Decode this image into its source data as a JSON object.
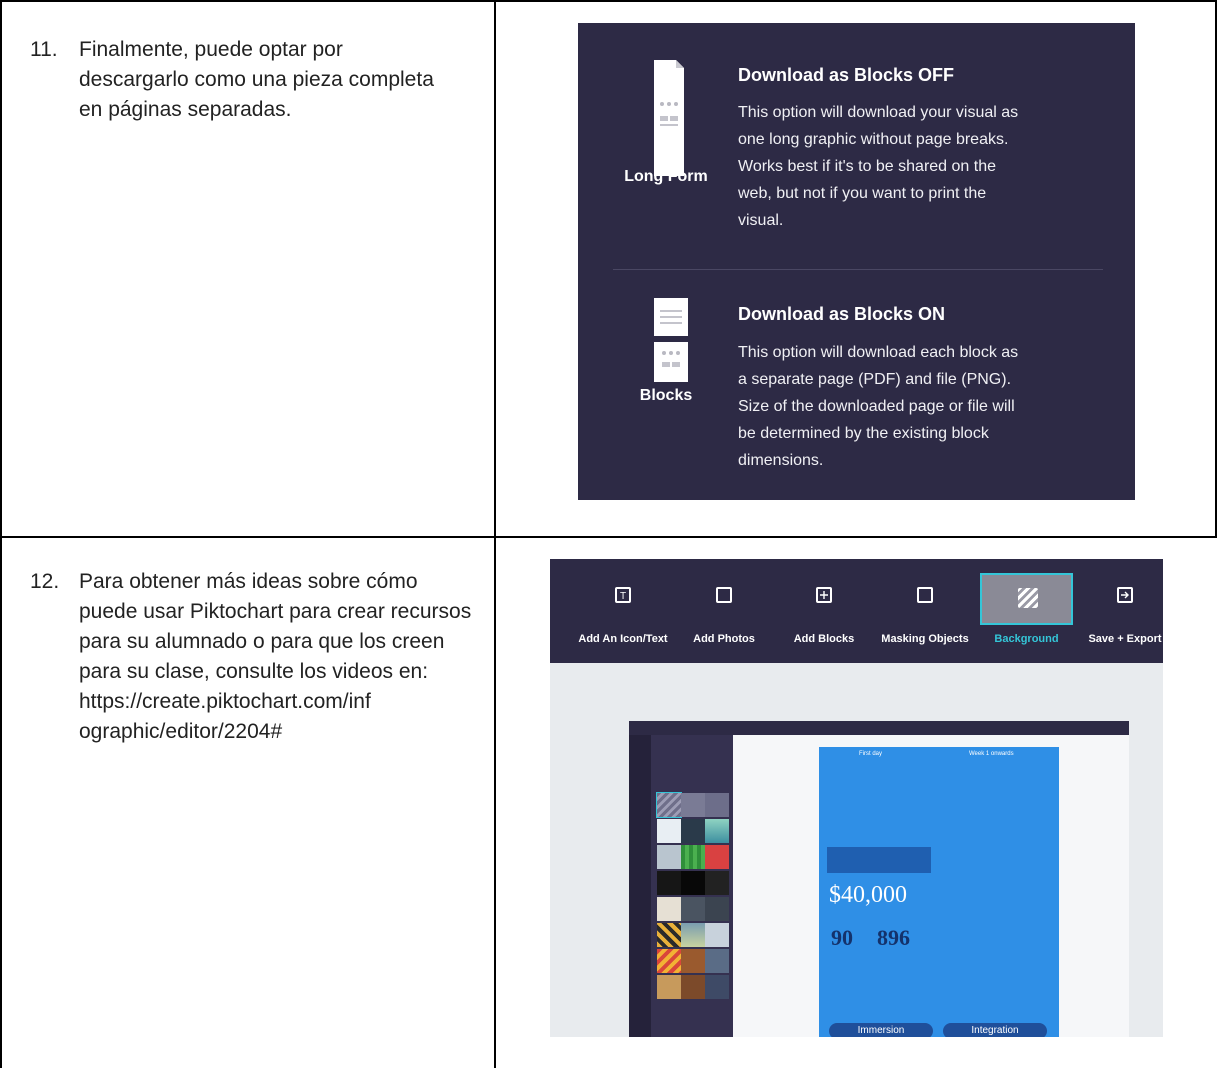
{
  "steps": [
    {
      "number": "11.",
      "text": "Finalmente, puede optar por descargarlo como una pieza completa en páginas separadas."
    },
    {
      "number": "12.",
      "text": "Para obtener más ideas sobre cómo puede usar Piktochart para crear recursos para su alumnado o para que los creen para su clase, consulte los videos en: https://create.piktochart.com/inf ographic/editor/2204#"
    }
  ],
  "download_options": [
    {
      "icon": "long-form-document-icon",
      "label": "Long Form",
      "title": "Download as Blocks OFF",
      "description": "This option will download your visual as\none long graphic without page breaks.\nWorks best if it's to be shared on the\nweb, but not if you want to print the\nvisual."
    },
    {
      "icon": "blocks-document-icon",
      "label": "Blocks",
      "title": "Download as Blocks ON",
      "description": "This option will download each block as\na separate page (PDF) and file (PNG).\nSize of the downloaded page or file will\nbe determined by the existing block\ndimensions."
    }
  ],
  "editor": {
    "toolbar": [
      {
        "label": "Add An Icon/Text",
        "icon": "text-icon",
        "active": false
      },
      {
        "label": "Add Photos",
        "icon": "photo-icon",
        "active": false
      },
      {
        "label": "Add Blocks",
        "icon": "plus-icon",
        "active": false
      },
      {
        "label": "Masking Objects",
        "icon": "mask-icon",
        "active": false
      },
      {
        "label": "Background",
        "icon": "background-icon",
        "active": true
      },
      {
        "label": "Save + Export",
        "icon": "export-icon",
        "active": false
      }
    ],
    "colors": {
      "toolbar_bg": "#2d2a45",
      "active_label": "#34c6d8",
      "canvas_blue": "#2f8fe6"
    },
    "canvas_text": {
      "amount": "$40,000",
      "days": "90",
      "applicants": "896",
      "col1": "First day",
      "col2": "Week 1 onwards",
      "banner1": "Immersion",
      "banner2": "Integration"
    }
  }
}
